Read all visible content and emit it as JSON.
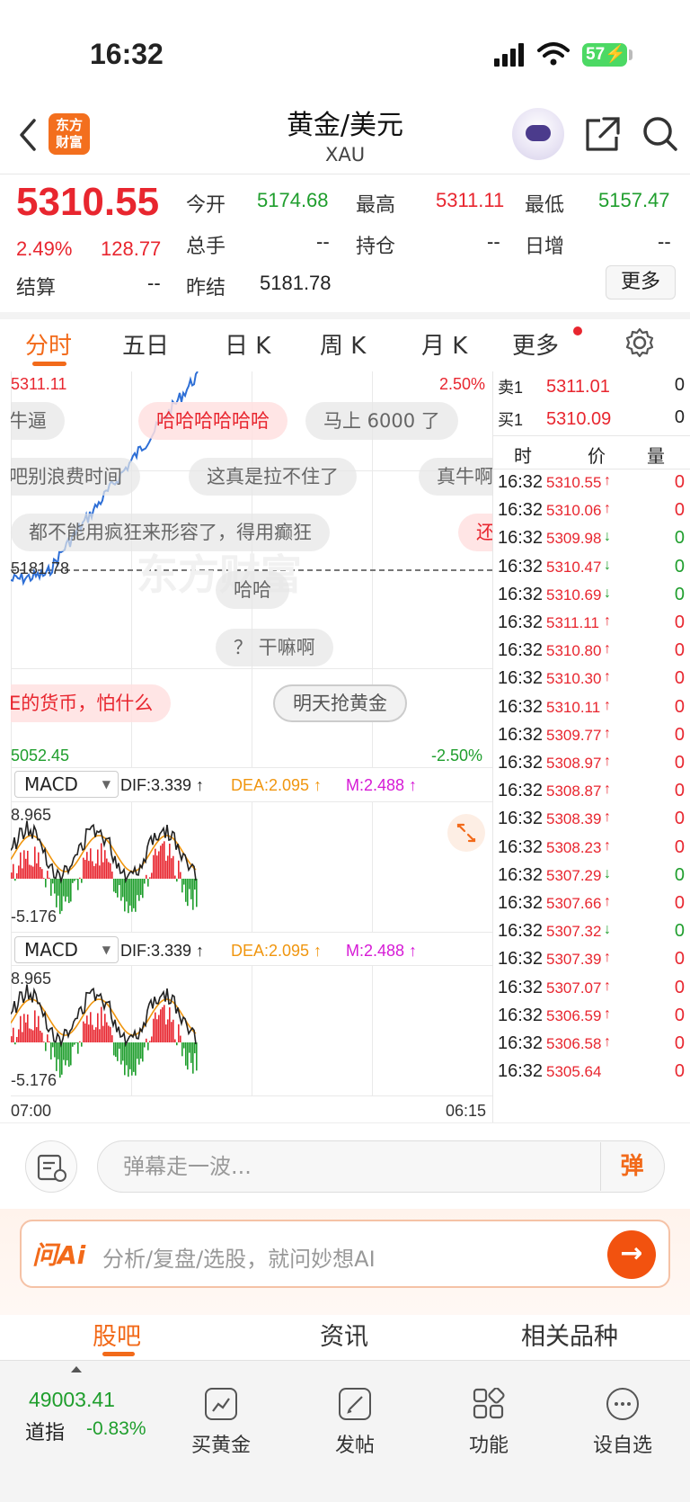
{
  "status_bar": {
    "time": "16:32",
    "battery": "57"
  },
  "header": {
    "logo_line1": "东方",
    "logo_line2": "财富",
    "title": "黄金/美元",
    "subtitle": "XAU"
  },
  "quote": {
    "price": "5310.55",
    "change_pct": "2.49%",
    "change": "128.77",
    "open_label": "今开",
    "open": "5174.68",
    "high_label": "最高",
    "high": "5311.11",
    "low_label": "最低",
    "low": "5157.47",
    "volume_label": "总手",
    "volume": "--",
    "position_label": "持仓",
    "position": "--",
    "daily_inc_label": "日增",
    "daily_inc": "--",
    "settle_label": "结算",
    "settle": "--",
    "prev_settle_label": "昨结",
    "prev_settle": "5181.78",
    "more_label": "更多"
  },
  "tabs": [
    {
      "label": "分时",
      "active": true
    },
    {
      "label": "五日"
    },
    {
      "label": "日 K"
    },
    {
      "label": "周 K"
    },
    {
      "label": "月 K"
    },
    {
      "label": "更多"
    }
  ],
  "chart": {
    "top_price": "5311.11",
    "top_pct": "2.50%",
    "mid_price": "5181.78",
    "bottom_price": "5052.45",
    "bottom_pct": "-2.50%",
    "watermark": "东方财富",
    "time_start": "07:00",
    "time_end": "06:15"
  },
  "danmaku": [
    "牛逼",
    "哈哈哈哈哈哈",
    "马上 6000 了",
    "吧别浪费时间",
    "这真是拉不住了",
    "真牛啊",
    "都不能用疯狂来形容了，得用癫狂",
    "还",
    "哈哈",
    "？ 干嘛啊",
    "E的货币，怕什么",
    "明天抢黄金"
  ],
  "macd": [
    {
      "name": "MACD",
      "dif": "DIF:3.339 ↑",
      "dea": "DEA:2.095 ↑",
      "m": "M:2.488 ↑",
      "max": "8.965",
      "min": "-5.176"
    },
    {
      "name": "MACD",
      "dif": "DIF:3.339 ↑",
      "dea": "DEA:2.095 ↑",
      "m": "M:2.488 ↑",
      "max": "8.965",
      "min": "-5.176"
    }
  ],
  "order_book": {
    "sell_label": "卖1",
    "sell_price": "5311.01",
    "sell_qty": "0",
    "buy_label": "买1",
    "buy_price": "5310.09",
    "buy_qty": "0",
    "col_time": "时",
    "col_price": "价",
    "col_qty": "量"
  },
  "ticks": [
    {
      "t": "16:32",
      "p": "5310.55",
      "d": "up",
      "q": "0"
    },
    {
      "t": "16:32",
      "p": "5310.06",
      "d": "up",
      "q": "0"
    },
    {
      "t": "16:32",
      "p": "5309.98",
      "d": "down",
      "q": "0"
    },
    {
      "t": "16:32",
      "p": "5310.47",
      "d": "down",
      "q": "0"
    },
    {
      "t": "16:32",
      "p": "5310.69",
      "d": "down",
      "q": "0"
    },
    {
      "t": "16:32",
      "p": "5311.11",
      "d": "up",
      "q": "0"
    },
    {
      "t": "16:32",
      "p": "5310.80",
      "d": "up",
      "q": "0"
    },
    {
      "t": "16:32",
      "p": "5310.30",
      "d": "up",
      "q": "0"
    },
    {
      "t": "16:32",
      "p": "5310.11",
      "d": "up",
      "q": "0"
    },
    {
      "t": "16:32",
      "p": "5309.77",
      "d": "up",
      "q": "0"
    },
    {
      "t": "16:32",
      "p": "5308.97",
      "d": "up",
      "q": "0"
    },
    {
      "t": "16:32",
      "p": "5308.87",
      "d": "up",
      "q": "0"
    },
    {
      "t": "16:32",
      "p": "5308.39",
      "d": "up",
      "q": "0"
    },
    {
      "t": "16:32",
      "p": "5308.23",
      "d": "up",
      "q": "0"
    },
    {
      "t": "16:32",
      "p": "5307.29",
      "d": "down",
      "q": "0"
    },
    {
      "t": "16:32",
      "p": "5307.66",
      "d": "up",
      "q": "0"
    },
    {
      "t": "16:32",
      "p": "5307.32",
      "d": "down",
      "q": "0"
    },
    {
      "t": "16:32",
      "p": "5307.39",
      "d": "up",
      "q": "0"
    },
    {
      "t": "16:32",
      "p": "5307.07",
      "d": "up",
      "q": "0"
    },
    {
      "t": "16:32",
      "p": "5306.59",
      "d": "up",
      "q": "0"
    },
    {
      "t": "16:32",
      "p": "5306.58",
      "d": "up",
      "q": "0"
    },
    {
      "t": "16:32",
      "p": "5305.64",
      "d": "",
      "q": "0"
    }
  ],
  "comment": {
    "placeholder": "弹幕走一波...",
    "danmu_btn": "弹"
  },
  "ai": {
    "logo": "问Ai",
    "placeholder": "分析/复盘/选股，就问妙想AI"
  },
  "subtabs": [
    {
      "label": "股吧",
      "active": true
    },
    {
      "label": "资讯"
    },
    {
      "label": "相关品种"
    }
  ],
  "bottom_nav": {
    "index_value": "49003.41",
    "index_name": "道指",
    "index_change": "-0.83%",
    "items": [
      {
        "label": "买黄金",
        "icon": "chart-icon"
      },
      {
        "label": "发帖",
        "icon": "edit-icon"
      },
      {
        "label": "功能",
        "icon": "grid-icon"
      },
      {
        "label": "设自选",
        "icon": "dots-icon"
      }
    ]
  }
}
